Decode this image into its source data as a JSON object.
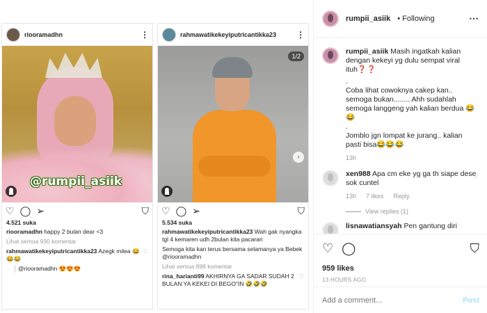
{
  "card1": {
    "username": "riooramadhn",
    "watermark": "@rumpii_asiik",
    "likes": "4.521 suka",
    "caption_user": "riooramadhn",
    "caption_text": "happy 2 bulan dear <3",
    "view_all": "Lihat semua 930 komentar",
    "comment_user": "rahmawatikekeyiputricantikka23",
    "comment_text": "Azegk milea 😂 😂😂",
    "reply_text": "@riooramadhn 😍😍😍"
  },
  "card2": {
    "username": "rahmawatikekeyiputricantikka23",
    "counter": "1/2",
    "likes": "5.534 suka",
    "caption_user": "rahmawatikekeyiputricantikka23",
    "caption_text": "Wah gak nyangka tgl 4 kemaren udh 2bulan kita pacaran",
    "caption_text2": "Semoga kita kan terus bersama selamanya ya Bebek @riooramadhn",
    "view_all": "Lihat semua 898 komentar",
    "comment_user": "rina_harianti99",
    "comment_text": "AKHIRNYA GA SADAR SUDAH 2 BULAN YA KEKEI DI BEGO\"IN 🤣🤣🤣"
  },
  "panel": {
    "username": "rumpii_asiik",
    "follow_status": "• Following",
    "caption_user": "rumpii_asiik",
    "caption_p1": "Masih ingatkah kalian dengan kekeyi yg dulu sempat viral ituh❓❓",
    "caption_p2": ".",
    "caption_p3": "Coba lihat cowoknya cakep kan.. semoga bukan........ Ahh sudahlah semoga langgeng yah kalian berdua 😂😂",
    "caption_p4": ".",
    "caption_p5": "Jomblo jgn lompat ke jurang.. kalian pasti bisa😂😂😂",
    "caption_time": "13h",
    "comment1_user": "xen988",
    "comment1_text": "Apa cm eke yg ga th siape dese sok cuntel",
    "comment1_time": "13h",
    "comment1_likes": "7 likes",
    "comment1_reply": "Reply",
    "view_replies": "View replies (1)",
    "comment2_user": "lisnawatiansyah",
    "comment2_text": "Pen gantung diri",
    "likes": "959 likes",
    "timestamp": "13 HOURS AGO",
    "add_comment_placeholder": "Add a comment...",
    "post_label": "Post"
  }
}
